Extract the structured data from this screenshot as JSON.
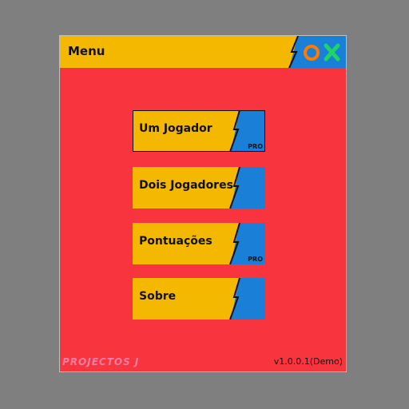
{
  "window": {
    "title": "Menu",
    "logo_letters": [
      "O",
      "X"
    ],
    "colors": {
      "background": "#f8353f",
      "yellow": "#f5b800",
      "blue": "#1a7fd6",
      "orange": "#ff7a00",
      "green": "#1fd36b"
    }
  },
  "menu": {
    "items": [
      {
        "label": "Um Jogador",
        "badge": "PRO",
        "selected": true
      },
      {
        "label": "Dois Jogadores",
        "badge": "",
        "selected": false
      },
      {
        "label": "Pontuações",
        "badge": "PRO",
        "selected": false
      },
      {
        "label": "Sobre",
        "badge": "",
        "selected": false
      }
    ]
  },
  "footer": {
    "brand": "PROJECTOS J",
    "version": "v1.0.0.1(Demo)"
  }
}
